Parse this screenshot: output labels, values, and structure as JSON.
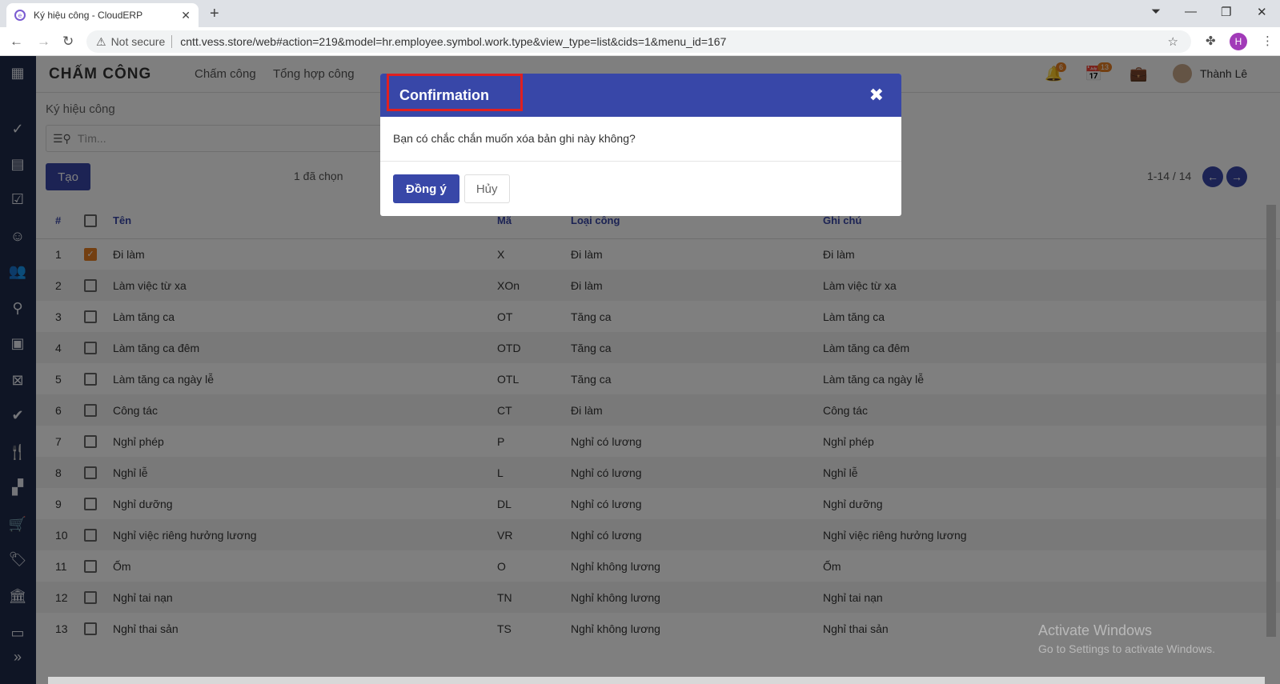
{
  "browser": {
    "tab_title": "Ký hiệu công - CloudERP",
    "security_label": "Not secure",
    "url": "cntt.vess.store/web#action=219&model=hr.employee.symbol.work.type&view_type=list&cids=1&menu_id=167",
    "profile_initial": "H"
  },
  "app": {
    "brand": "CHẤM CÔNG",
    "menu": [
      "Chấm công",
      "Tổng hợp công"
    ],
    "notifications_count": "6",
    "calendar_count": "13",
    "user_name": "Thành Lê"
  },
  "list": {
    "breadcrumb": "Ký hiệu công",
    "search_placeholder": "Tìm...",
    "create_label": "Tạo",
    "selected_label": "1 đã chọn",
    "pager": "1-14 / 14",
    "headers": {
      "num": "#",
      "name": "Tên",
      "code": "Mã",
      "type": "Loại công",
      "note": "Ghi chú"
    },
    "rows": [
      {
        "num": "1",
        "name": "Đi làm",
        "code": "X",
        "type": "Đi làm",
        "note": "Đi làm",
        "checked": true
      },
      {
        "num": "2",
        "name": "Làm việc từ xa",
        "code": "XOn",
        "type": "Đi làm",
        "note": "Làm việc từ xa"
      },
      {
        "num": "3",
        "name": "Làm tăng ca",
        "code": "OT",
        "type": "Tăng ca",
        "note": "Làm tăng ca"
      },
      {
        "num": "4",
        "name": "Làm tăng ca đêm",
        "code": "OTD",
        "type": "Tăng ca",
        "note": "Làm tăng ca đêm"
      },
      {
        "num": "5",
        "name": "Làm tăng ca ngày lễ",
        "code": "OTL",
        "type": "Tăng ca",
        "note": "Làm tăng ca ngày lễ"
      },
      {
        "num": "6",
        "name": "Công tác",
        "code": "CT",
        "type": "Đi làm",
        "note": "Công tác"
      },
      {
        "num": "7",
        "name": "Nghỉ phép",
        "code": "P",
        "type": "Nghỉ có lương",
        "note": "Nghỉ phép"
      },
      {
        "num": "8",
        "name": "Nghỉ lễ",
        "code": "L",
        "type": "Nghỉ có lương",
        "note": "Nghỉ lễ"
      },
      {
        "num": "9",
        "name": "Nghỉ dưỡng",
        "code": "DL",
        "type": "Nghỉ có lương",
        "note": "Nghỉ dưỡng"
      },
      {
        "num": "10",
        "name": "Nghỉ việc riêng hưởng lương",
        "code": "VR",
        "type": "Nghỉ có lương",
        "note": "Nghỉ việc riêng hưởng lương"
      },
      {
        "num": "11",
        "name": "Ốm",
        "code": "O",
        "type": "Nghỉ không lương",
        "note": "Ốm"
      },
      {
        "num": "12",
        "name": "Nghỉ tai nạn",
        "code": "TN",
        "type": "Nghỉ không lương",
        "note": "Nghỉ tai nạn"
      },
      {
        "num": "13",
        "name": "Nghỉ thai sản",
        "code": "TS",
        "type": "Nghỉ không lương",
        "note": "Nghỉ thai sản"
      }
    ]
  },
  "modal": {
    "title": "Confirmation",
    "message": "Bạn có chắc chắn muốn xóa bản ghi này không?",
    "ok_label": "Đồng ý",
    "cancel_label": "Hủy"
  },
  "watermark": {
    "line1": "Activate Windows",
    "line2": "Go to Settings to activate Windows."
  },
  "colors": {
    "primary": "#3847a8",
    "sidebar": "#1e2a4a",
    "accent": "#e67e22",
    "highlight": "#e02020"
  }
}
